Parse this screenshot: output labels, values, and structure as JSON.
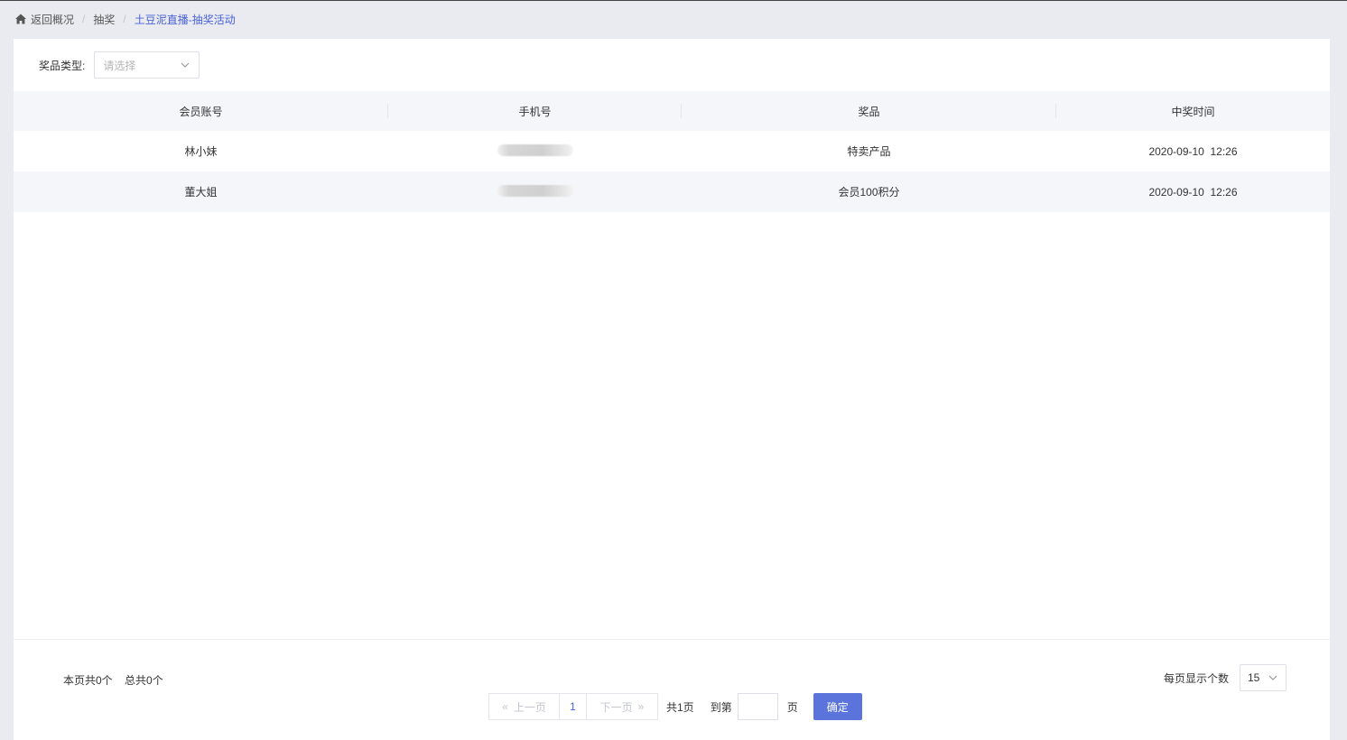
{
  "breadcrumb": {
    "home_icon": "home-icon",
    "back": "返回概况",
    "section": "抽奖",
    "current": "土豆泥直播-抽奖活动"
  },
  "filter": {
    "label": "奖品类型:",
    "placeholder": "请选择"
  },
  "table": {
    "headers": [
      "会员账号",
      "手机号",
      "奖品",
      "中奖时间"
    ],
    "rows": [
      {
        "account": "林小妹",
        "phone": "",
        "prize": "特卖产品",
        "time": "2020-09-10  12:26"
      },
      {
        "account": "董大姐",
        "phone": "",
        "prize": "会员100积分",
        "time": "2020-09-10  12:26"
      }
    ]
  },
  "summary": {
    "page_count": "本页共0个",
    "total_count": "总共0个"
  },
  "pager": {
    "prev": "上一页",
    "current": "1",
    "next": "下一页",
    "total_pages": "共1页",
    "goto": "到第",
    "page_unit": "页",
    "confirm": "确定"
  },
  "per_page": {
    "label": "每页显示个数",
    "value": "15"
  },
  "colors": {
    "accent": "#4a63d6",
    "button": "#5a74dc",
    "background": "#e9ebf0",
    "row_alt": "#f5f6fa"
  }
}
